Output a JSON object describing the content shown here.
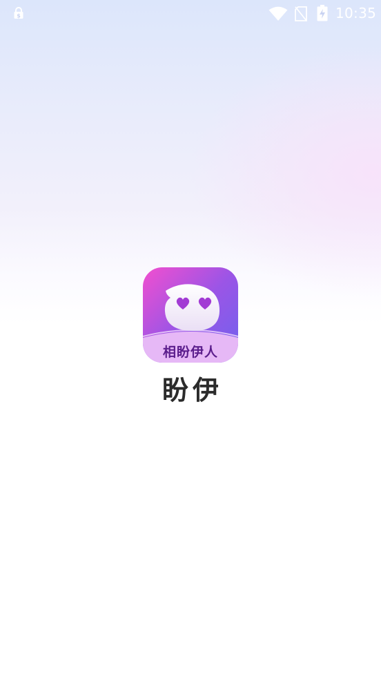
{
  "status_bar": {
    "time": "10:35",
    "icons": [
      "lock-notification-icon",
      "wifi-icon",
      "no-sim-icon",
      "battery-charging-icon"
    ]
  },
  "splash": {
    "icon_label": "相盼伊人",
    "app_name": "盼伊"
  },
  "colors": {
    "icon_top": "#f24fcf",
    "icon_mid": "#9b55e6",
    "icon_bottom": "#6f62ee",
    "icon_band": "#e6b8f6",
    "icon_label_text": "#5b1d8c",
    "hearts": "#a23bd4",
    "app_name_text": "#2b2b2b"
  }
}
